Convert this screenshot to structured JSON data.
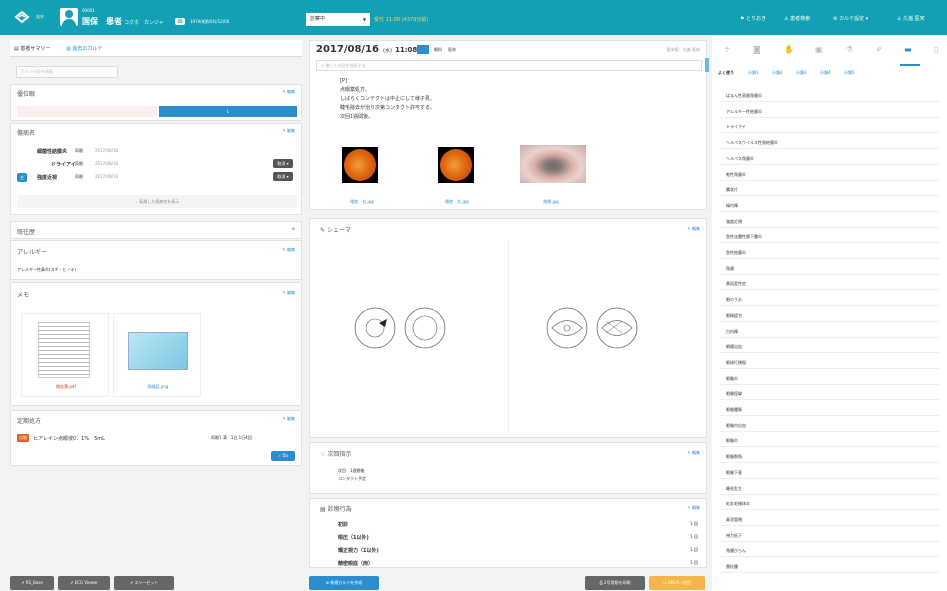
{
  "topbar": {
    "version": "嵐宋",
    "patient_id": "00001",
    "patient_name": "国保　患者",
    "patient_kana": "コクホ　カンジャ",
    "age": "35",
    "dob": "1979(昭和54)/12/06",
    "status": "診察中",
    "reception": "受付 11:08 (4379分前)",
    "nav": [
      "とりおき",
      "患者検索",
      "カルテ設定 ▾",
      "久嵐 医宋"
    ],
    "colors": {
      "header": "#12a0b4",
      "accent": "#2c8ecf"
    }
  },
  "left": {
    "tabs": [
      "患者サマリー",
      "過去のカルテ"
    ],
    "search_placeholder": "カルテ内容を検索",
    "sections": {
      "risk": "優位眼",
      "disease": "傷病名",
      "history": "既往歴",
      "allergy": "アレルギー",
      "memo": "メモ",
      "prescription": "定期処方"
    },
    "edit": "編集",
    "risk_bar_label": "L",
    "diseases": [
      {
        "name": "細菌性結膜炎",
        "eye": "両眼",
        "date": "2017/08/16",
        "badge": ""
      },
      {
        "name": "ドライアイ",
        "eye": "両眼",
        "date": "2017/08/16",
        "badge": "",
        "btn": "取消 ▾"
      },
      {
        "name": "強度近視",
        "eye": "両眼",
        "date": "2017/08/16",
        "badge": "主",
        "btn": "取消 ▾"
      }
    ],
    "show_more": "転帰した傷病名を表示",
    "allergy_text": "アレルギー性鼻炎(スギ・ヒノキ)",
    "files": [
      {
        "name": "問診票.pdf"
      },
      {
        "name": "保険証.png"
      }
    ],
    "rx": {
      "badge": "点眼",
      "drug": "ヒアレイン点眼液0．1%　5mL",
      "dose": "両眼1 滴　1日 1日4回",
      "do": "✓ Do"
    },
    "bottom": [
      "RS_Base",
      "ECG Viewer",
      "スリーゼット"
    ]
  },
  "center": {
    "date": "2017/08/16",
    "dow": "(水)",
    "time": "11:08",
    "badge": "",
    "dept": "眼科",
    "doc": "医宋",
    "right_info": "医宋医：久嵐 医宋",
    "search_placeholder": "書いた内容を検索する",
    "notes": [
      "[P]",
      "点眼薬処方。",
      "しばらくコンテクトは中止にして様子見。",
      "睫毛除去が治り次第コンタクト許可する。",
      "次回1週間後。"
    ],
    "images": [
      {
        "caption": "眼底 - 右.jpg"
      },
      {
        "caption": "眼底 - 左.jpg"
      },
      {
        "caption": "前眼.jpg"
      }
    ],
    "schema": "シェーマ",
    "next": "次回指示",
    "next_text": [
      "次回　1週間後",
      "コンタクト予定"
    ],
    "treat": "診療行為",
    "treats": [
      {
        "name": "初診",
        "count": "1 回"
      },
      {
        "name": "眼圧（1以外)",
        "count": "1 回"
      },
      {
        "name": "矯正視力（1以外)",
        "count": "1 回"
      },
      {
        "name": "精密眼底（両）",
        "count": "1 回"
      }
    ],
    "edit": "編集",
    "new_btn": "新規カルテを作成",
    "print_btn": "2号用紙を印刷",
    "orca_btn": "ORCAへ送信"
  },
  "right": {
    "tabs": [
      "よく使う",
      "分類1",
      "分類2",
      "分類3",
      "分類4",
      "分類5"
    ],
    "items": [
      "ぱまん性表層角膜炎",
      "アレルギー性結膜炎",
      "ドライアイ",
      "ヘルペスウイルス性角結膜炎",
      "ヘルペス角膜炎",
      "乾性角膜炎",
      "翼状片",
      "緑内障",
      "強度近視",
      "急性化膿性篩下膿炎",
      "急性結膜炎",
      "角膜",
      "黄斑変性症",
      "眼のうお",
      "眼精疲労",
      "白内障",
      "網膜出血",
      "眼球打撲傷",
      "眼瞼炎",
      "眼瞼痙攣",
      "眼瞼腫脹",
      "眼瞼内出血",
      "眼瞼炎",
      "眼瞼裂傷",
      "眼瞼下垂",
      "睫毛乱生",
      "虹彩毛様体炎",
      "鼻涙管閉",
      "視力低下",
      "角膜びらん",
      "霰粒腫"
    ]
  }
}
